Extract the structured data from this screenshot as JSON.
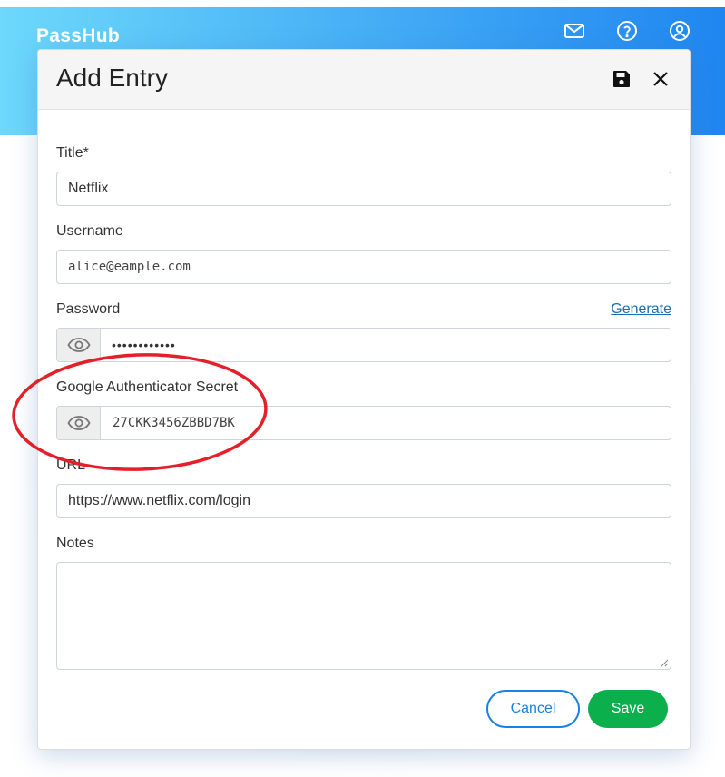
{
  "app": {
    "name": "PassHub",
    "icons": [
      "mail-icon",
      "help-icon",
      "user-icon"
    ]
  },
  "modal": {
    "title": "Add Entry",
    "header_icons": [
      "save-icon",
      "close-icon"
    ]
  },
  "form": {
    "title_label": "Title*",
    "title_value": "Netflix",
    "username_label": "Username",
    "username_value": "alice@eample.com",
    "password_label": "Password",
    "password_value": "••••••••••••",
    "generate_label": "Generate",
    "secret_label": "Google Authenticator Secret",
    "secret_value": "27CKK3456ZBBD7BK",
    "url_label": "URL",
    "url_value": "https://www.netflix.com/login",
    "notes_label": "Notes",
    "notes_value": ""
  },
  "buttons": {
    "cancel": "Cancel",
    "save": "Save"
  },
  "colors": {
    "header_gradient_start": "#6dd8fb",
    "header_gradient_end": "#1f86f0",
    "primary": "#1a7fe8",
    "save_green": "#0bb04c",
    "annotation_red": "#e3202a"
  }
}
